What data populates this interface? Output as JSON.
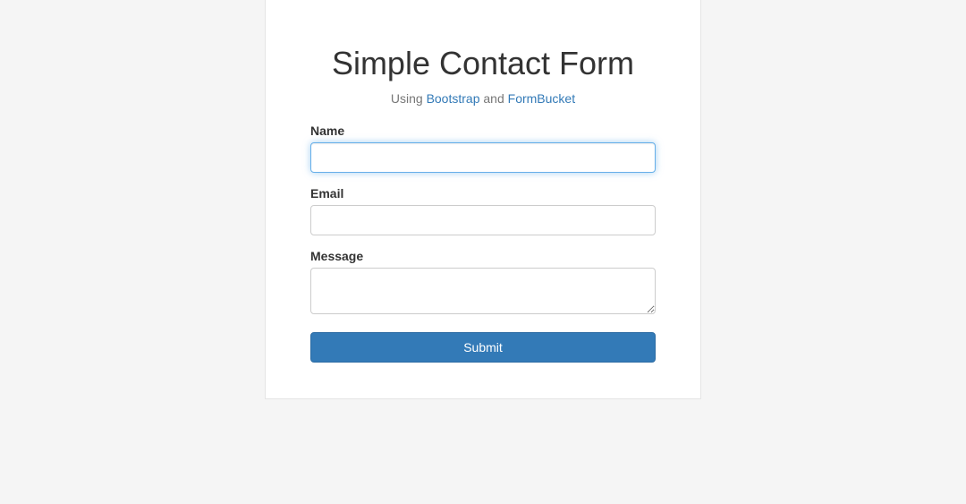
{
  "header": {
    "title": "Simple Contact Form",
    "subtitle_prefix": "Using ",
    "link1": "Bootstrap",
    "subtitle_middle": " and ",
    "link2": "FormBucket"
  },
  "form": {
    "name": {
      "label": "Name",
      "value": ""
    },
    "email": {
      "label": "Email",
      "value": ""
    },
    "message": {
      "label": "Message",
      "value": ""
    },
    "submit_label": "Submit"
  }
}
